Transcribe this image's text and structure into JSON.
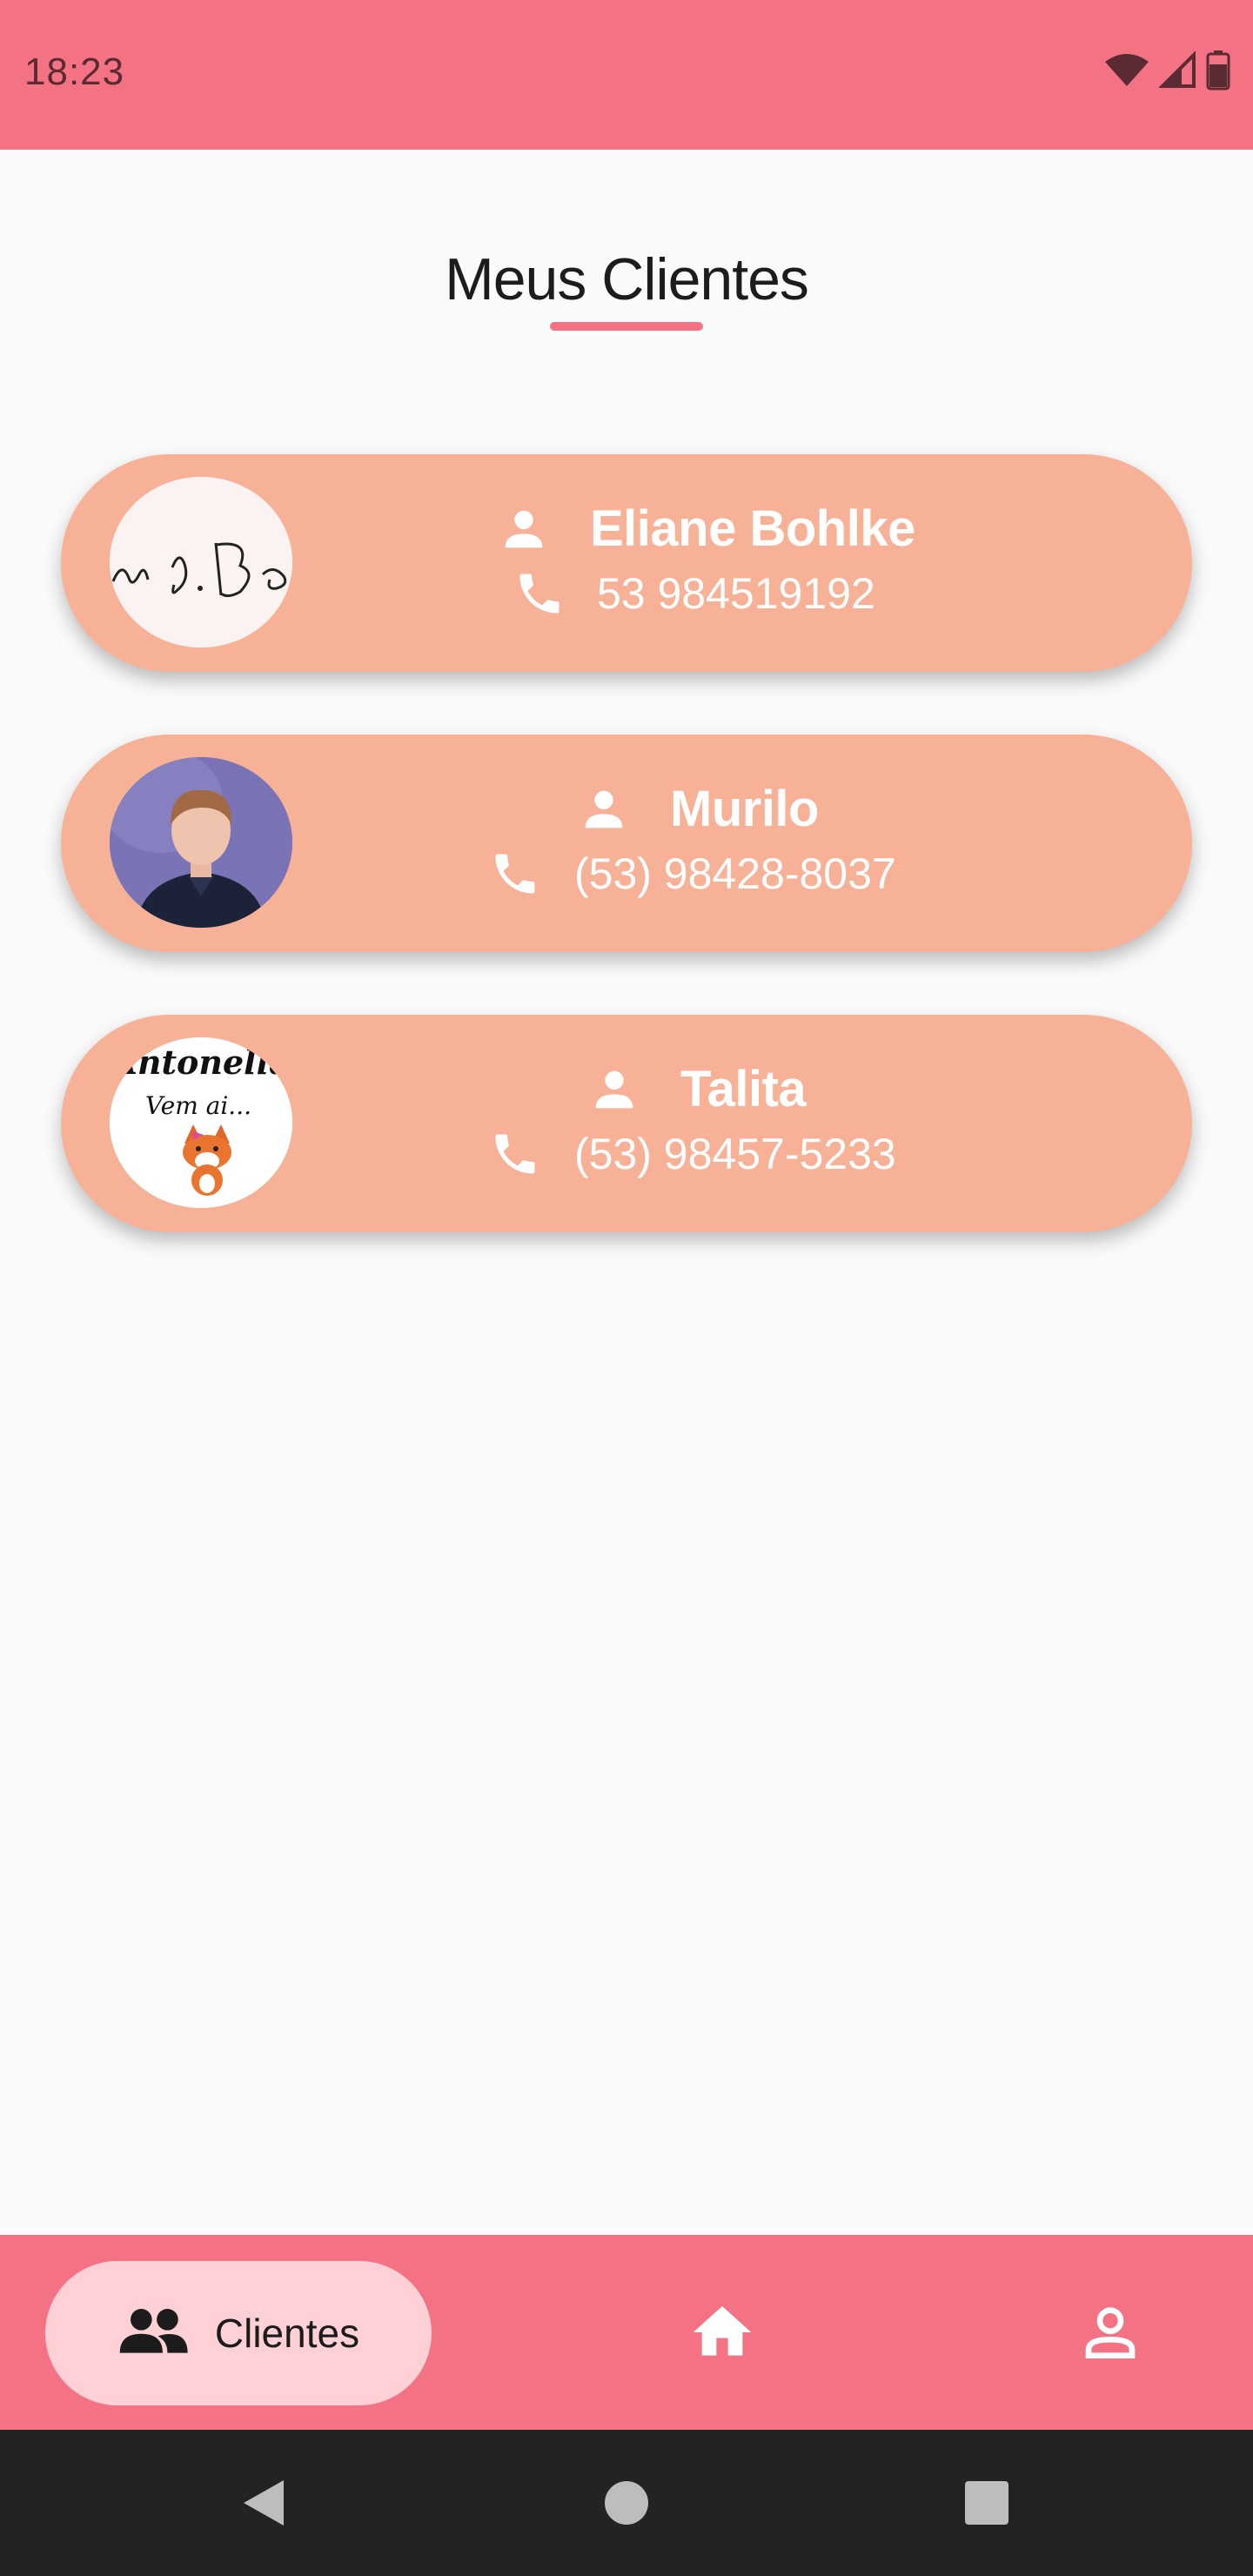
{
  "status_bar": {
    "time": "18:23",
    "icons": [
      "wifi-icon",
      "signal-icon",
      "battery-icon"
    ]
  },
  "page": {
    "title": "Meus Clientes"
  },
  "clients": [
    {
      "name": "Eliane Bohlke",
      "phone": "53 984519192",
      "avatar": "signature-image"
    },
    {
      "name": "Murilo",
      "phone": "(53) 98428-8037",
      "avatar": "person-photo"
    },
    {
      "name": "Talita",
      "phone": "(53) 98457-5233",
      "avatar": "antonella-fox-image",
      "avatar_text": [
        "Antonella",
        "Vem ai..."
      ]
    }
  ],
  "bottom_nav": {
    "active_label": "Clientes",
    "items": [
      "clientes",
      "home",
      "profile"
    ]
  },
  "colors": {
    "primary": "#f37283",
    "card": "#f7b196",
    "pill": "#ffd0d5",
    "background": "#fafafa"
  }
}
